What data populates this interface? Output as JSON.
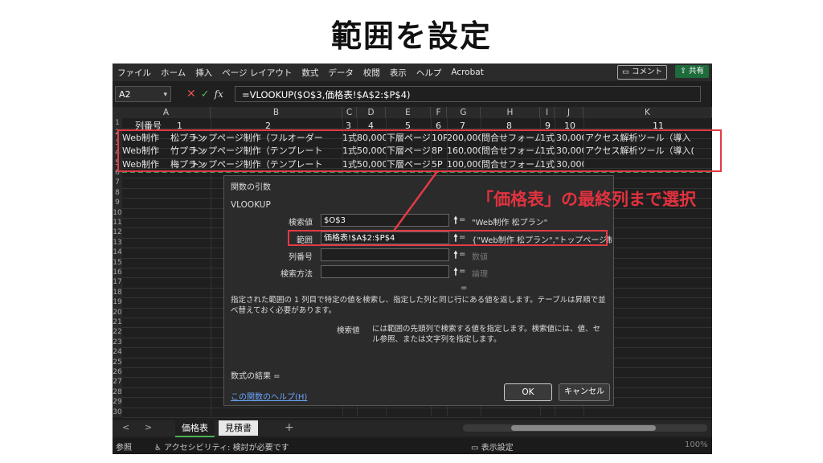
{
  "page_heading": "範囲を設定",
  "menu": [
    "ファイル",
    "ホーム",
    "挿入",
    "ページ レイアウト",
    "数式",
    "データ",
    "校閲",
    "表示",
    "ヘルプ",
    "Acrobat"
  ],
  "comment_label": "コメント",
  "share_label": "共有",
  "formula_bar": {
    "name_box": "A2",
    "cancel_glyph": "✕",
    "confirm_glyph": "✓",
    "fx_label": "fx",
    "formula": "=VLOOKUP($O$3,価格表!$A$2:$P$4)"
  },
  "columns": [
    "A",
    "B",
    "C",
    "D",
    "E",
    "F",
    "G",
    "H",
    "I",
    "J",
    "K"
  ],
  "rows": {
    "row1": [
      "列番号",
      "1",
      "2",
      "3",
      "4",
      "5",
      "6",
      "7",
      "8",
      "9",
      "10",
      "11"
    ],
    "row2": [
      "Web制作",
      "松プラン",
      "トップページ制作（フルオーダー",
      "1式",
      "80,000",
      "下層ページ",
      "10P",
      "200,000",
      "問合せフォーム",
      "1式",
      "30,000",
      "アクセス解析ツール（導入"
    ],
    "row3": [
      "Web制作",
      "竹プラン",
      "トップページ制作（テンプレート",
      "1式",
      "50,000",
      "下層ページ",
      "8P",
      "160,000",
      "問合せフォーム",
      "1式",
      "30,000",
      "アクセス解析ツール（導入("
    ],
    "row4": [
      "Web制作",
      "梅プラン",
      "トップページ制作（テンプレート",
      "1式",
      "50,000",
      "下層ページ",
      "5P",
      "100,000",
      "問合せフォーム",
      "1式",
      "30,000"
    ]
  },
  "row_numbers": [
    "1",
    "2",
    "3",
    "4",
    "5",
    "6",
    "7",
    "8",
    "9",
    "10",
    "11",
    "12",
    "13",
    "14",
    "15",
    "16",
    "17",
    "18",
    "19",
    "20",
    "21",
    "22",
    "23",
    "24",
    "25",
    "26",
    "27",
    "28",
    "29",
    "30"
  ],
  "dialog": {
    "title": "関数の引数",
    "function": "VLOOKUP",
    "args": [
      {
        "label": "検索値",
        "value": "$O$3",
        "result": "\"Web制作 松プラン\""
      },
      {
        "label": "範囲",
        "value": "価格表!$A$2:$P$4",
        "result": "{\"Web制作 松プラン\",\"トップページ制作（"
      },
      {
        "label": "列番号",
        "value": "",
        "result": "数値"
      },
      {
        "label": "検索方法",
        "value": "",
        "result": "論理"
      }
    ],
    "upload_glyph": "🠕",
    "equals": "=",
    "description": "指定された範囲の 1 列目で特定の値を検索し、指定した列と同じ行にある値を返します。テーブルは昇順で並べ替えておく必要があります。",
    "arg_name": "検索値",
    "arg_description": "には範囲の先頭列で検索する値を指定します。検索値には、値、セル参照、または文字列を指定します。",
    "result_label": "数式の結果 =",
    "help_link": "この関数のヘルプ(H)",
    "ok_label": "OK",
    "cancel_label": "キャンセル"
  },
  "callout": "「価格表」の最終列まで選択",
  "sheet_tabs": [
    {
      "label": "価格表",
      "active": true
    },
    {
      "label": "見積書",
      "active": false
    }
  ],
  "tab_nav": {
    "prev": "<",
    "next": ">",
    "add": "+"
  },
  "status": {
    "mode": "参照",
    "accessibility": "アクセシビリティ: 検討が必要です",
    "display_settings": "表示設定",
    "zoom": "100%"
  },
  "colors": {
    "accent_red": "#e23b44",
    "share_green": "#1e6b3c"
  }
}
